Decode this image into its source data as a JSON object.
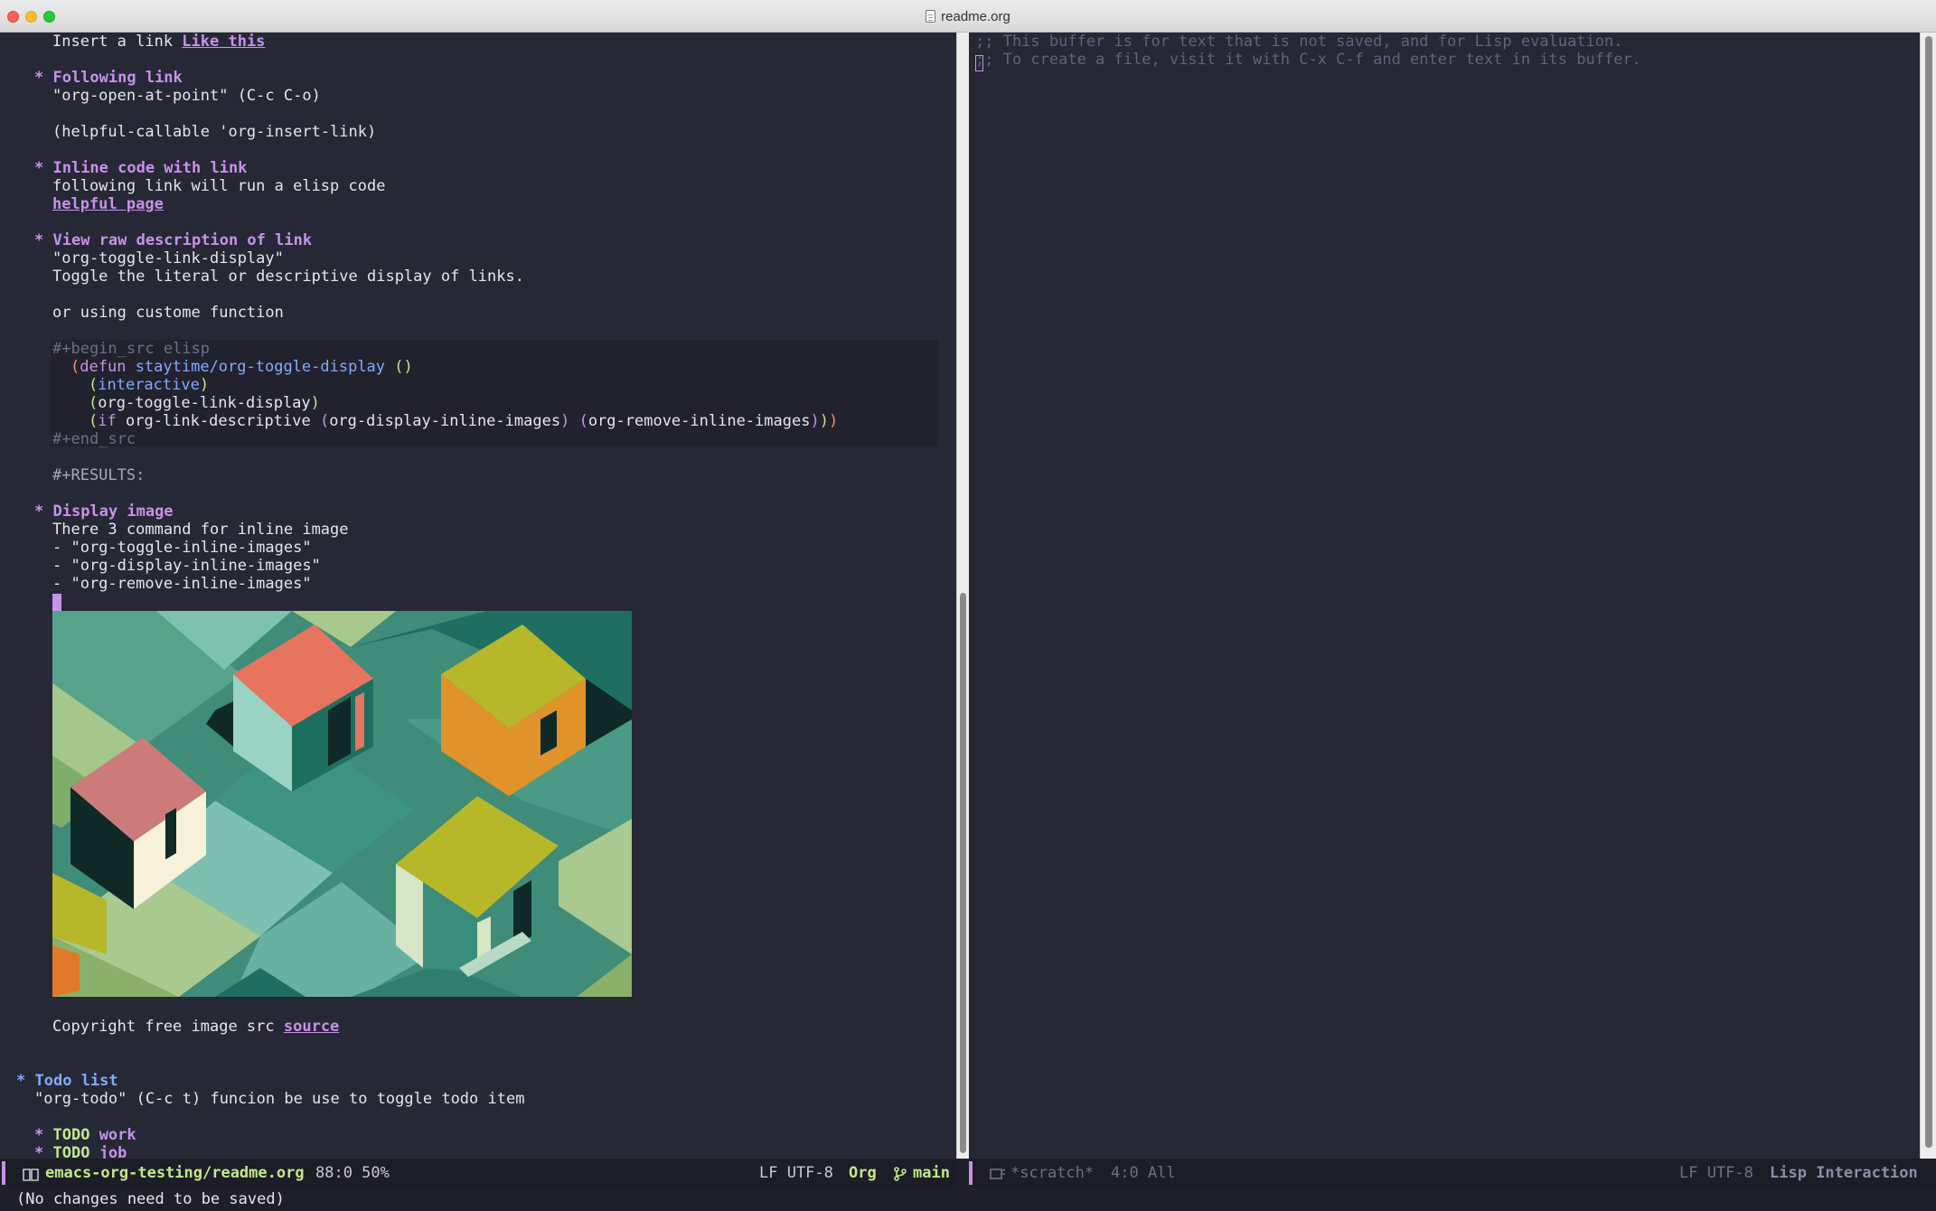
{
  "window": {
    "title": "readme.org"
  },
  "left": {
    "lines": {
      "l1": "Insert a link ",
      "l1_link": "Like this",
      "h_follow": "Following link",
      "follow_cmd": "\"org-open-at-point\" (C-c C-o)",
      "helpful": "(helpful-callable 'org-insert-link)",
      "h_inline": "Inline code with link",
      "inline_text": "following link will run a elisp code",
      "inline_link": "helpful page",
      "h_view": "View raw description of link",
      "view_cmd": "\"org-toggle-link-display\"",
      "view_desc": "Toggle the literal or descriptive display of links.",
      "custom": "or using custome function",
      "begin_src": "#+begin_src elisp",
      "defun_kw": "defun",
      "defun_name": "staytime/org-toggle-display",
      "interactive": "interactive",
      "toggle_call": "org-toggle-link-display",
      "if_kw": "if",
      "if_cond": "org-link-descriptive",
      "display_call": "org-display-inline-images",
      "remove_call": "org-remove-inline-images",
      "end_src": "#+end_src",
      "results": "#+RESULTS:",
      "h_display": "Display image",
      "display_text": "There 3 command for inline image",
      "item1": "- \"org-toggle-inline-images\"",
      "item2": "- \"org-display-inline-images\"",
      "item3": "- \"org-remove-inline-images\"",
      "copyright": "Copyright free image src ",
      "source_link": "source",
      "h_todo": "Todo list",
      "todo_desc": "\"org-todo\" (C-c t) funcion be use to toggle todo item",
      "todo_kw1": "TODO",
      "todo_item1": "work",
      "todo_kw2": "TODO",
      "todo_item2": "job"
    },
    "modeline": {
      "file": "emacs-org-testing/readme.org",
      "position": "88:0 50%",
      "encoding": "LF UTF-8",
      "mode": "Org",
      "branch": "main"
    }
  },
  "right": {
    "comment1": ";; This buffer is for text that is not saved, and for Lisp evaluation.",
    "comment2": ";; To create a file, visit it with C-x C-f and enter text in its buffer.",
    "modeline": {
      "buffer": "*scratch*",
      "position": "4:0 All",
      "encoding": "LF UTF-8",
      "mode": "Lisp Interaction"
    }
  },
  "minibuffer": {
    "message": "(No changes need to be saved)"
  },
  "colors": {
    "heading": "#c792ea",
    "todo": "#c3e88d",
    "background": "#262836"
  }
}
